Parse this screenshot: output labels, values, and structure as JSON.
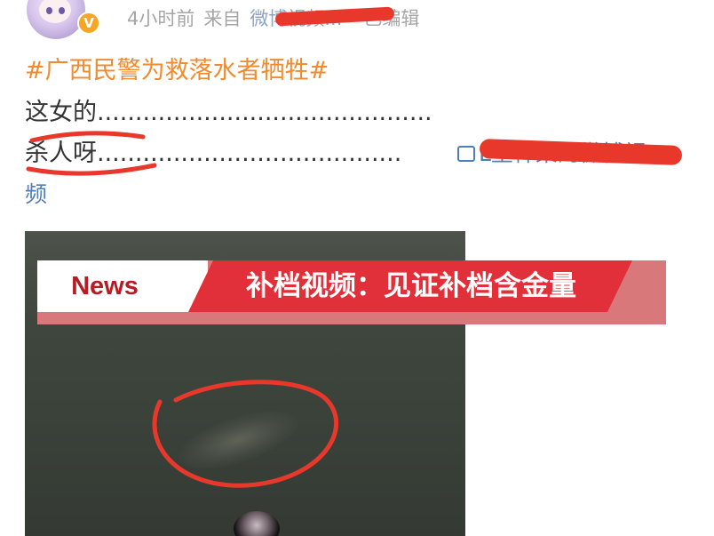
{
  "post_header": {
    "time": "4小时前",
    "source_prefix": "来自",
    "source_name": "微博视频...",
    "edited_label": "已编辑",
    "verified_badge": "V"
  },
  "post": {
    "hashtag": "#广西民警为救落水者牺牲#",
    "line1": "这女的............................................",
    "line2": "杀人呀........................................",
    "video_link": "L里神某的微博视",
    "video_link_cont": "频"
  },
  "video": {
    "banner_tag": "News",
    "banner_title": "补档视频：见证补档含金量"
  },
  "colors": {
    "hashtag": "#f08a2c",
    "link": "#4f7fb8",
    "meta": "#a6a6a6",
    "annotation": "#e8382c",
    "banner_red": "#e2303a",
    "banner_tag_text": "#b71c24"
  }
}
